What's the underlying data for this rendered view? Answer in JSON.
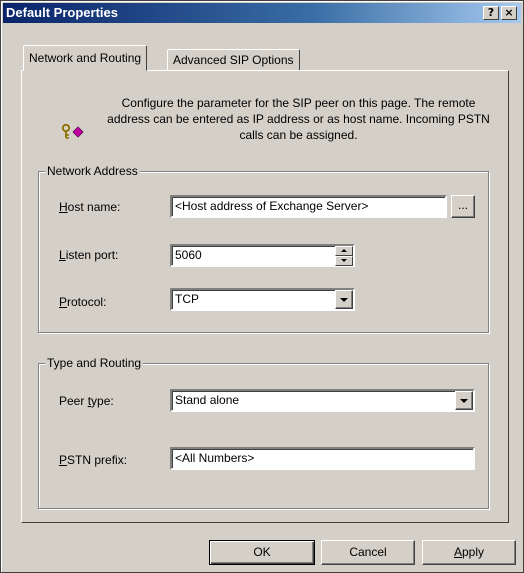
{
  "window": {
    "title": "Default Properties",
    "help_label": "?",
    "close_label": "×"
  },
  "tabs": [
    {
      "label": "Network and Routing",
      "active": true
    },
    {
      "label": "Advanced SIP Options",
      "active": false
    }
  ],
  "info": {
    "icon": "key-icon",
    "text": "Configure the parameter for the SIP peer on this page. The remote address can be entered as IP address or as host name. Incoming PSTN calls can be assigned."
  },
  "network_address": {
    "legend": "Network Address",
    "host_name": {
      "label_u": "H",
      "label_rest": "ost name:",
      "value": "<Host address of Exchange Server>",
      "browse_label": "..."
    },
    "listen_port": {
      "label_u": "L",
      "label_rest": "isten port:",
      "value": "5060"
    },
    "protocol": {
      "label_u": "P",
      "label_rest": "rotocol:",
      "value": "TCP"
    }
  },
  "type_routing": {
    "legend": "Type and Routing",
    "peer_type": {
      "label_pre": "Peer ",
      "label_u": "t",
      "label_rest": "ype:",
      "value": "Stand alone"
    },
    "pstn_prefix": {
      "label_u": "P",
      "label_rest": "STN prefix:",
      "value": "<All Numbers>"
    }
  },
  "buttons": {
    "ok": "OK",
    "cancel": "Cancel",
    "apply_u": "A",
    "apply_rest": "pply"
  }
}
